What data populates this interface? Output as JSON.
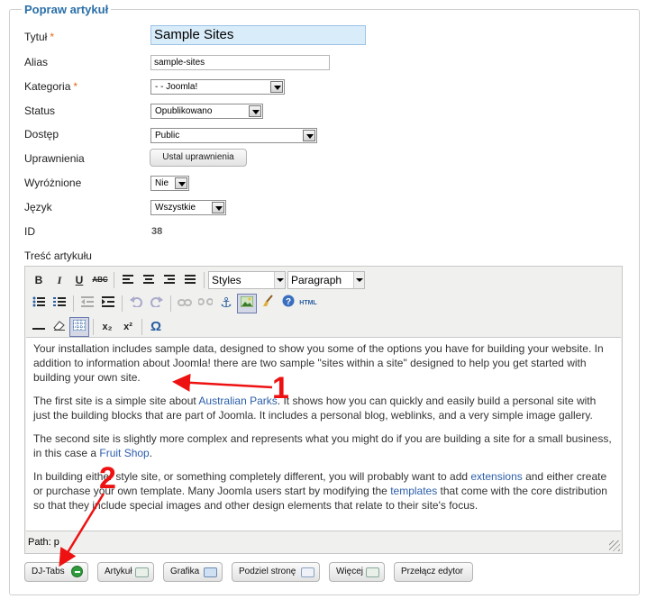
{
  "legend": "Popraw artykuł",
  "fields": {
    "title": {
      "label": "Tytuł",
      "required": "*",
      "value": "Sample Sites"
    },
    "alias": {
      "label": "Alias",
      "value": "sample-sites"
    },
    "category": {
      "label": "Kategoria",
      "required": "*",
      "value": "- - Joomla!"
    },
    "status": {
      "label": "Status",
      "value": "Opublikowano"
    },
    "access": {
      "label": "Dostęp",
      "value": "Public"
    },
    "permissions": {
      "label": "Uprawnienia",
      "button": "Ustal uprawnienia"
    },
    "featured": {
      "label": "Wyróżnione",
      "value": "Nie"
    },
    "language": {
      "label": "Język",
      "value": "Wszystkie"
    },
    "id": {
      "label": "ID",
      "value": "38"
    },
    "content_label": "Treść artykułu"
  },
  "editor": {
    "styles_select": "Styles",
    "format_select": "Paragraph",
    "html_label": "HTML",
    "toolbar_text": {
      "bold": "B",
      "italic": "I",
      "underline": "U",
      "strike": "ABC",
      "sub": "x₂",
      "sup": "x²",
      "omega": "Ω"
    },
    "paragraphs": [
      {
        "pre": "Your installation includes sample data, designed to show you some of the options you have for building your website. In addition to information about Joomla! there are two sample \"sites within a site\" designed to help you get started with building your own site.",
        "link": "",
        "post": ""
      },
      {
        "pre": "The first site is a simple site about ",
        "link": "Australian Parks",
        "post": ". It shows how you can quickly and easily build a personal site with just the building blocks that are part of Joomla. It includes a personal blog, weblinks, and a very simple image gallery."
      },
      {
        "pre": "The second site is slightly more complex and represents what you might do if you are building a site for a small business, in this case a ",
        "link": "Fruit Shop",
        "post": "."
      },
      {
        "pre": "In building either style site, or something completely different, you will probably want to add ",
        "link": "extensions",
        "post": " and either create or purchase your own template. Many Joomla users start by modifying the ",
        "link2": "templates",
        "post2": " that come with the core distribution so that they include special images and other design elements that relate to their site's focus."
      }
    ],
    "path": "Path: p"
  },
  "buttons": {
    "djtabs": "DJ-Tabs",
    "article": "Artykuł",
    "image": "Grafika",
    "pagebreak": "Podziel stronę",
    "readmore": "Więcej",
    "toggle": "Przełącz edytor"
  },
  "annotations": {
    "one": "1",
    "two": "2"
  },
  "colors": {
    "legend": "#2a6fa8",
    "link": "#2b5eaa",
    "annotation": "#ee1111",
    "title_bg": "#d9ecfa"
  }
}
